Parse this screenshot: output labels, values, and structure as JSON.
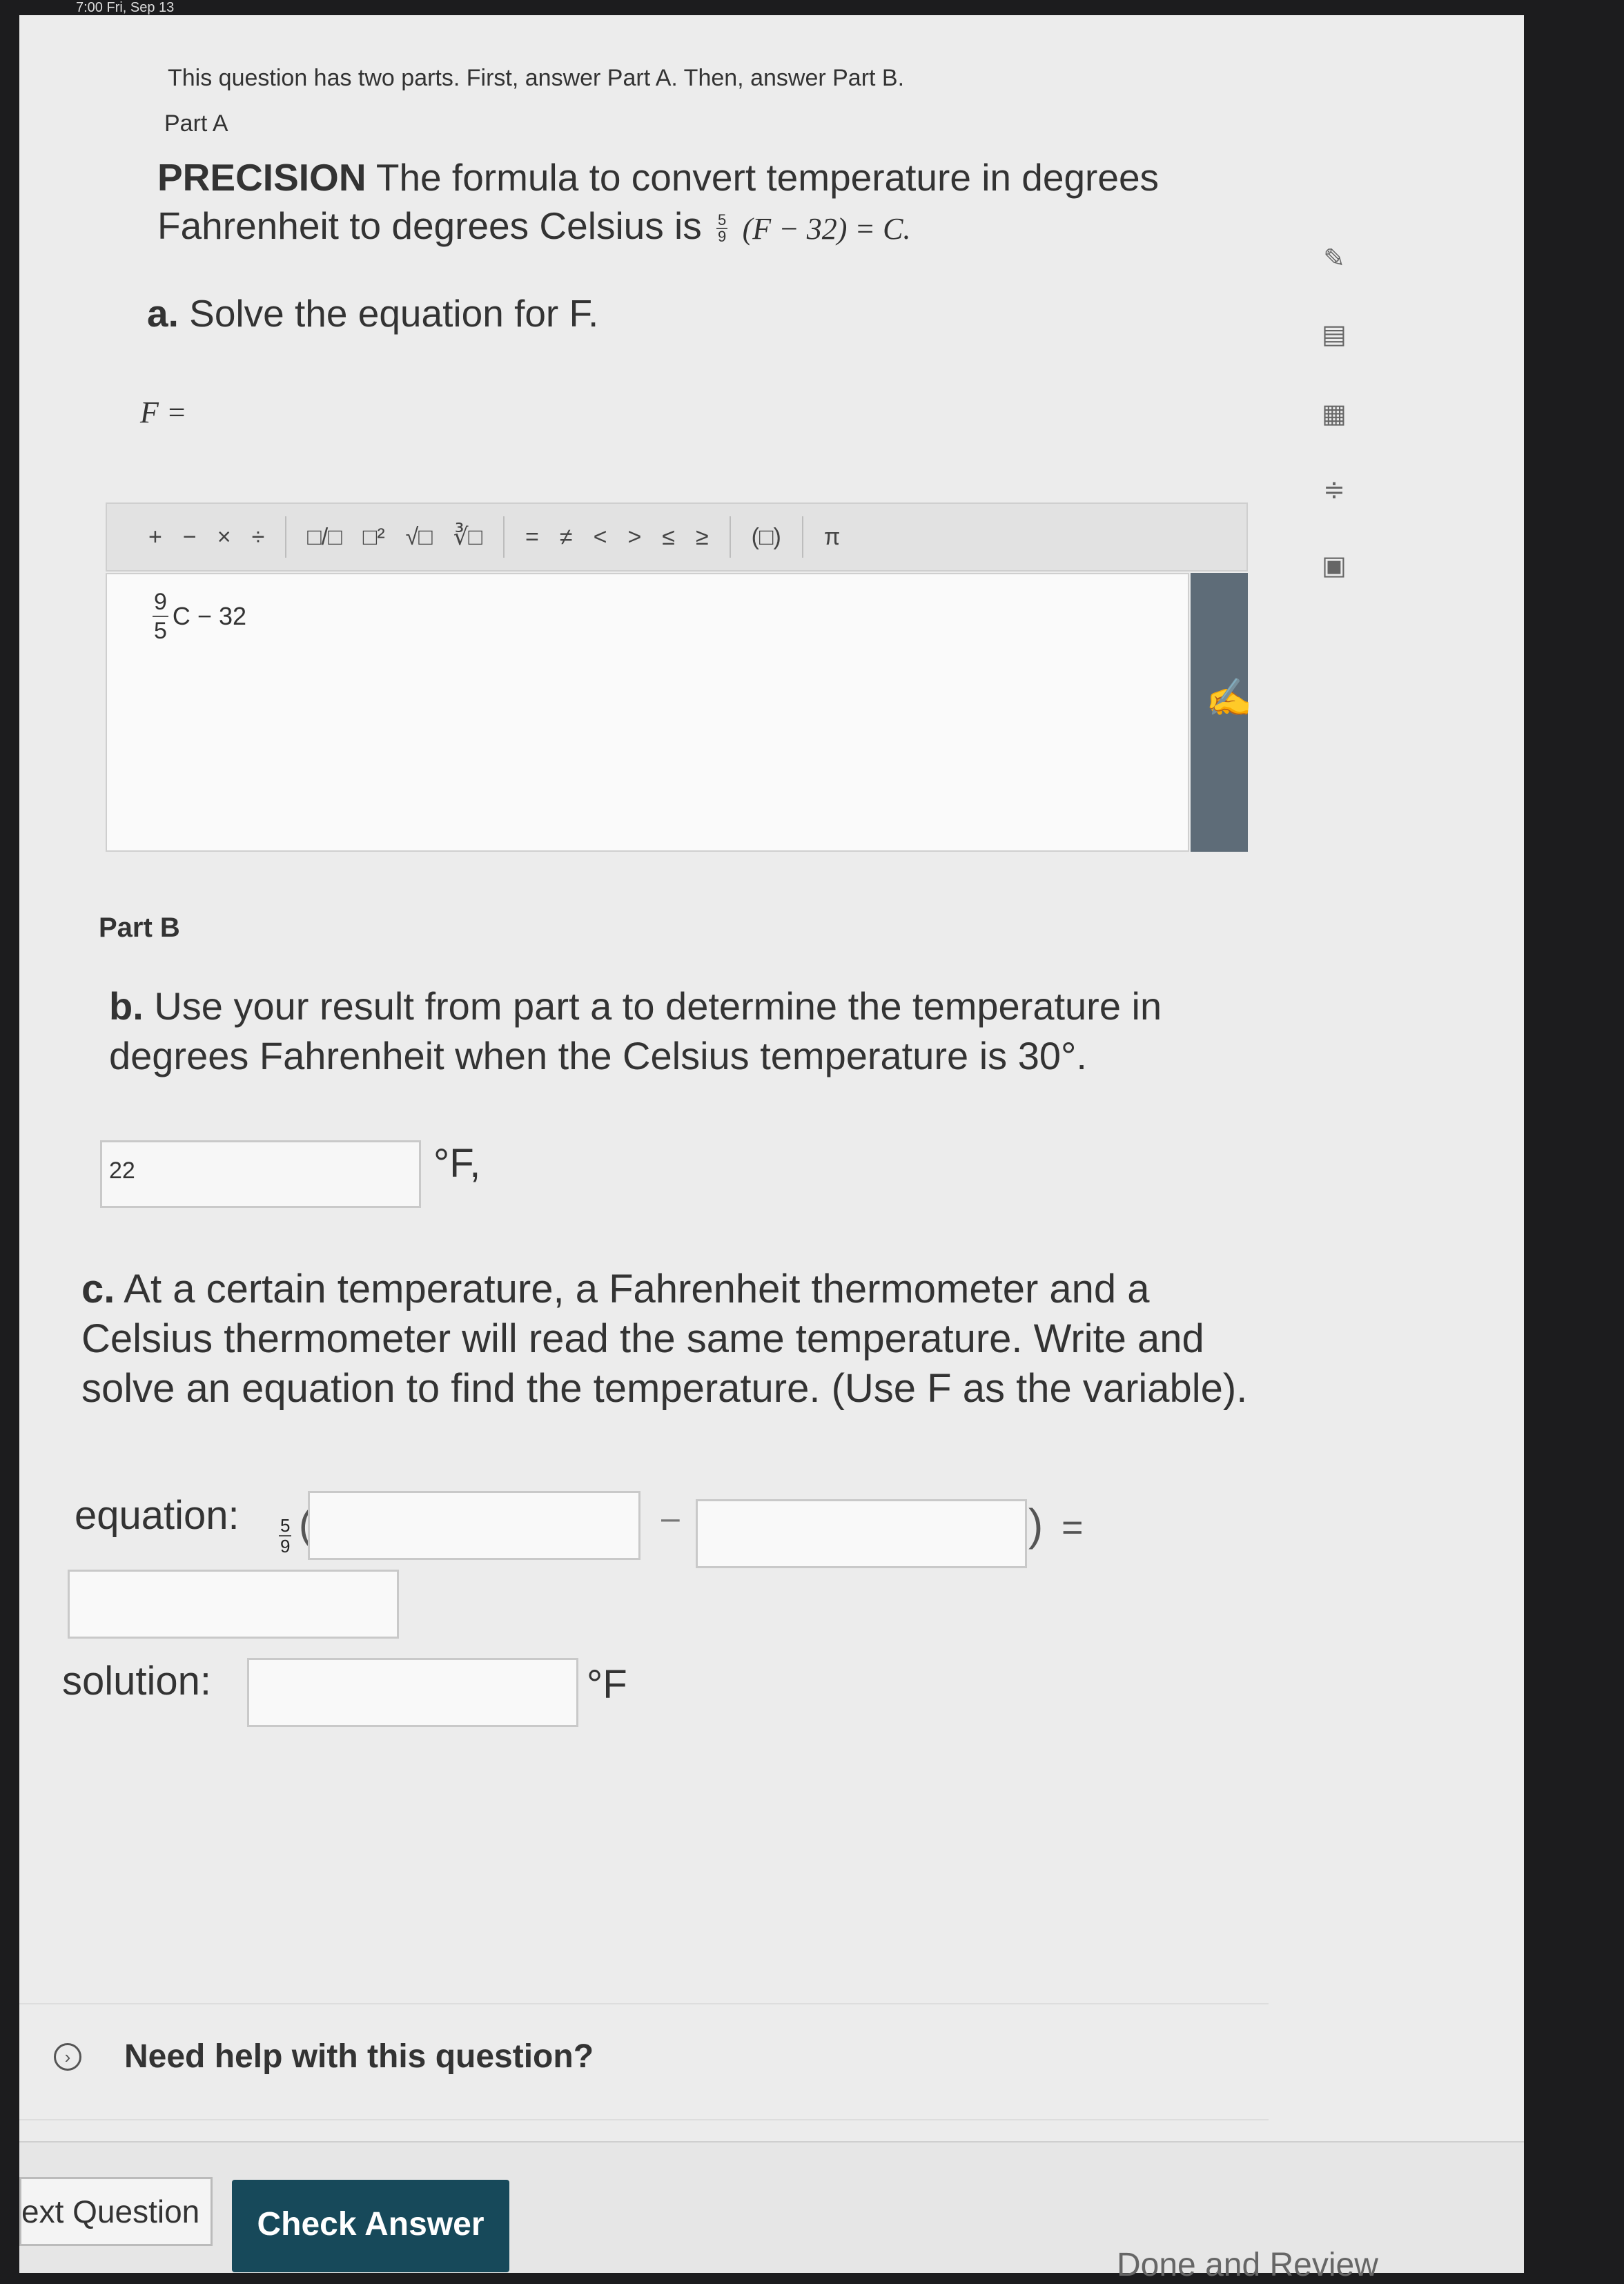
{
  "status_bar": {
    "time_text": "7:00  Fri, Sep 13"
  },
  "intro": "This question has two parts. First, answer Part A. Then, answer Part B.",
  "part_a": {
    "label": "Part A",
    "precision_title": "PRECISION",
    "precision_text": "The formula to convert temperature in degrees Fahrenheit to degrees Celsius is",
    "formula_num": "5",
    "formula_den": "9",
    "formula_rest": "(F − 32) = C.",
    "question_letter": "a.",
    "question_text": "Solve the equation for F.",
    "answer_prefix": "F ="
  },
  "toolbar": {
    "plus": "+",
    "minus": "−",
    "times": "×",
    "divide": "÷",
    "fraction": "□/□",
    "power": "□²",
    "sqrt": "√□",
    "nthroot": "∛□",
    "eq": "=",
    "neq": "≠",
    "lt": "<",
    "gt": ">",
    "le": "≤",
    "ge": "≥",
    "paren": "(□)",
    "pi": "π"
  },
  "editor": {
    "frac_num": "9",
    "frac_den": "5",
    "expr_rest": "C − 32"
  },
  "side_icons": [
    "pencil-icon",
    "notes-icon",
    "calculator-icon",
    "formula-icon",
    "reference-icon"
  ],
  "part_b": {
    "label": "Part B",
    "question_letter": "b.",
    "question_text": "Use your result from part a to determine the temperature in degrees Fahrenheit when the Celsius temperature is 30°.",
    "answer_value": "22",
    "answer_unit": "°F,"
  },
  "part_c": {
    "question_letter": "c.",
    "question_text": "At a certain temperature, a Fahrenheit thermometer and a Celsius thermometer will read the same temperature. Write and solve an equation to find the temperature. (Use F as the variable).",
    "equation_label": "equation:",
    "eq_frac_num": "5",
    "eq_frac_den": "9",
    "open_paren": "(",
    "minus": "–",
    "close_paren": ")",
    "equals": "=",
    "solution_label": "solution:",
    "solution_unit": "°F"
  },
  "help": {
    "text": "Need help with this question?"
  },
  "footer": {
    "next_label": "ext Question",
    "check_label": "Check Answer",
    "done_label": "Done and Review"
  }
}
